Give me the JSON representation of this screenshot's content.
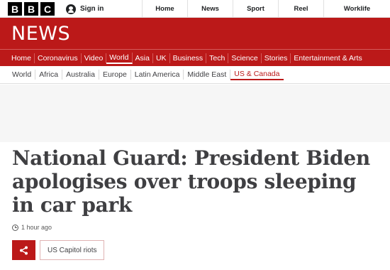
{
  "masthead": {
    "logo_letters": [
      "B",
      "B",
      "C"
    ],
    "signin_label": "Sign in",
    "global_nav": [
      "Home",
      "News",
      "Sport",
      "Reel",
      "Worklife"
    ]
  },
  "banner": {
    "title": "NEWS",
    "color": "#bb1919"
  },
  "section_nav": {
    "items": [
      "Home",
      "Coronavirus",
      "Video",
      "World",
      "Asia",
      "UK",
      "Business",
      "Tech",
      "Science",
      "Stories",
      "Entertainment & Arts"
    ],
    "active": "World"
  },
  "sub_nav": {
    "items": [
      "World",
      "Africa",
      "Australia",
      "Europe",
      "Latin America",
      "Middle East",
      "US & Canada"
    ],
    "active": "US & Canada"
  },
  "article": {
    "headline": "National Guard: President Biden apologises over troops sleeping in car park",
    "timestamp": "1 hour ago",
    "tag_label": "US Capitol riots"
  },
  "icons": {
    "user": "signin-user-icon",
    "clock": "clock-icon",
    "share": "share-icon"
  }
}
